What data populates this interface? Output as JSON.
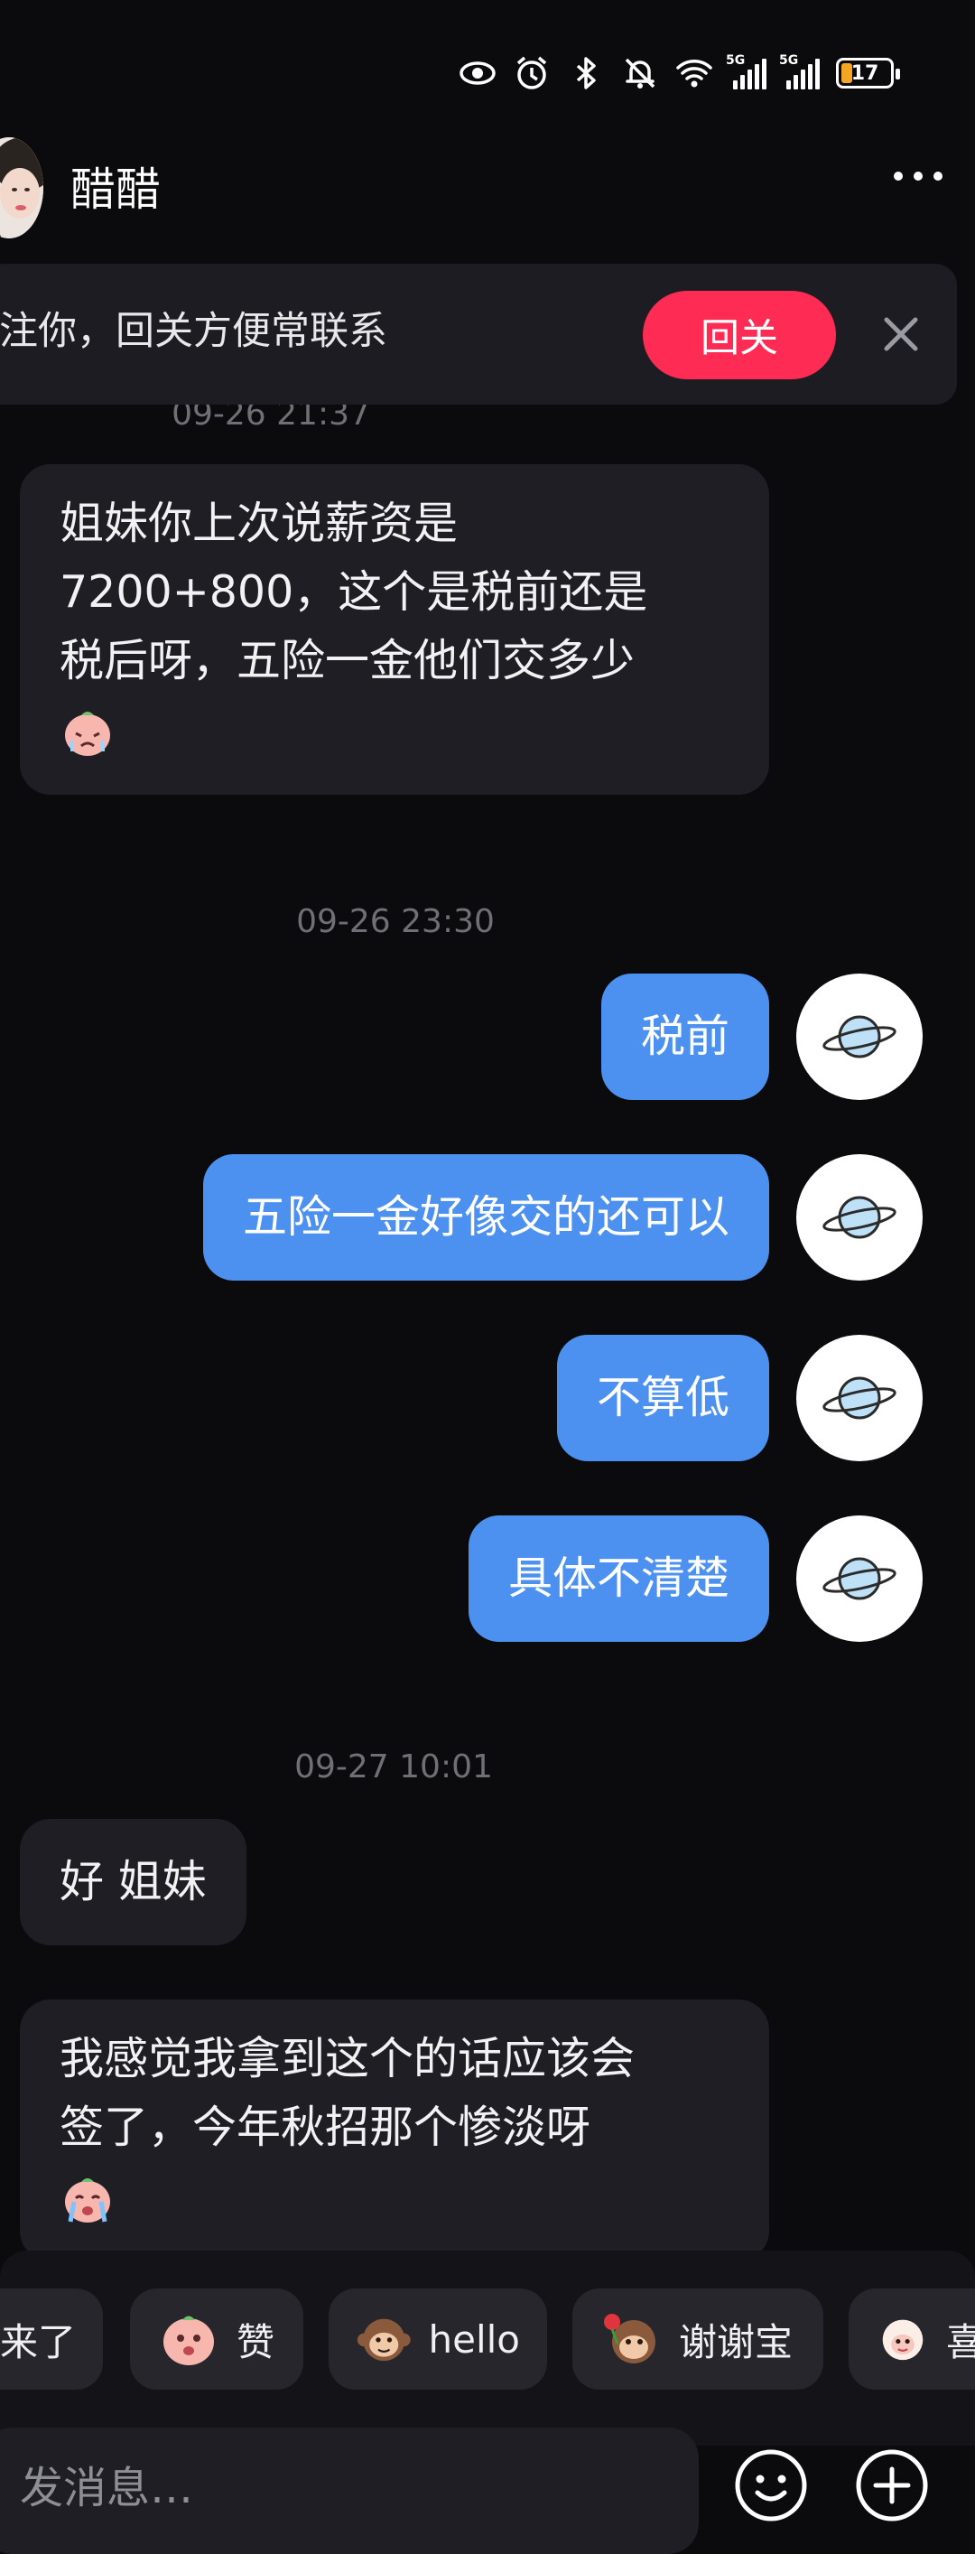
{
  "status_bar": {
    "signal_1_label": "5G",
    "signal_2_label": "5G",
    "battery_level": "17",
    "icons": [
      "eye-icon",
      "alarm-icon",
      "bluetooth-icon",
      "mute-icon",
      "wifi-icon"
    ]
  },
  "header": {
    "title": "醋醋"
  },
  "follow_banner": {
    "text": "关注你，回关方便常联系",
    "button_label": "回关"
  },
  "messages": {
    "time_1": "09-26 21:37",
    "msg_in_1": [
      "姐妹你上次说薪资是",
      "7200+800，这个是税前还是",
      "税后呀，五险一金他们交多少"
    ],
    "time_2": "09-26 23:30",
    "msg_out_1": "税前",
    "msg_out_2": "五险一金好像交的还可以",
    "msg_out_3": "不算低",
    "msg_out_4": "具体不清楚",
    "time_3": "09-27 10:01",
    "msg_in_2": "好 姐妹",
    "msg_in_3": [
      "我感觉我拿到这个的话应该会",
      "签了，今年秋招那个惨淡呀"
    ]
  },
  "quick_replies": [
    {
      "label": "来了"
    },
    {
      "label": "赞"
    },
    {
      "label": "hello"
    },
    {
      "label": "谢谢宝"
    },
    {
      "label": "喜"
    }
  ],
  "input": {
    "placeholder": "发消息…"
  },
  "colors": {
    "background": "#0b0b0d",
    "outgoing_bubble": "#4c91f0",
    "incoming_bubble": "#1e1e24",
    "follow_button": "#fe2c55"
  }
}
